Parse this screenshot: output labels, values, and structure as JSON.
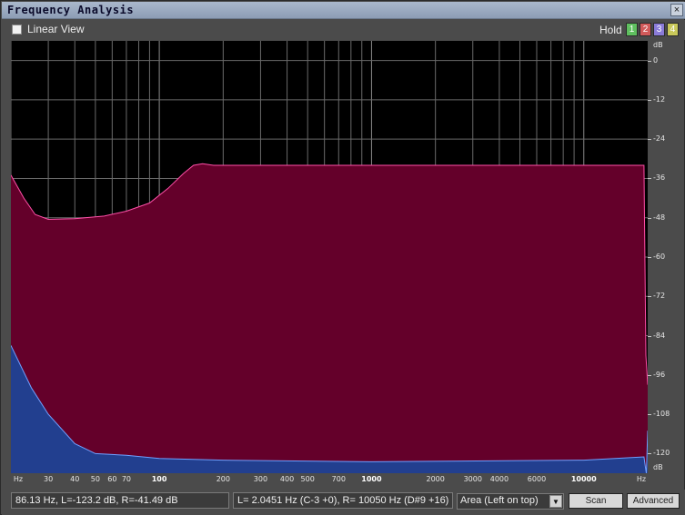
{
  "window": {
    "title": "Frequency Analysis",
    "close_glyph": "×"
  },
  "toolbar": {
    "linear_view_label": "Linear View",
    "linear_view_checked": false,
    "hold_label": "Hold",
    "hold_buttons": [
      {
        "label": "1",
        "color": "#5fbf5f"
      },
      {
        "label": "2",
        "color": "#d25a5a"
      },
      {
        "label": "3",
        "color": "#8a7bd8"
      },
      {
        "label": "4",
        "color": "#c8c85a"
      }
    ]
  },
  "colors": {
    "left_channel_fill": "#64002a",
    "left_channel_line": "#ff4fa8",
    "right_channel_fill": "#223f8f",
    "right_channel_line": "#6fa0ff",
    "grid": "#6a6a6a"
  },
  "chart_data": {
    "type": "area",
    "db_unit_label": "dB",
    "hz_unit_label": "Hz",
    "x_scale": "log",
    "xlim": [
      20,
      20000
    ],
    "ylim": [
      -126,
      6
    ],
    "y_ticks": [
      0,
      -12,
      -24,
      -36,
      -48,
      -60,
      -72,
      -84,
      -96,
      -108,
      -120
    ],
    "y_tick_labels": [
      "0",
      "-12",
      "-24",
      "-36",
      "-48",
      "-60",
      "-72",
      "-84",
      "-96",
      "-108",
      "-120"
    ],
    "x_ticks": [
      {
        "value": 30,
        "label": "30",
        "major": false
      },
      {
        "value": 40,
        "label": "40",
        "major": false
      },
      {
        "value": 50,
        "label": "50",
        "major": false
      },
      {
        "value": 60,
        "label": "60",
        "major": false
      },
      {
        "value": 70,
        "label": "70",
        "major": false
      },
      {
        "value": 100,
        "label": "100",
        "major": true
      },
      {
        "value": 200,
        "label": "200",
        "major": false
      },
      {
        "value": 300,
        "label": "300",
        "major": false
      },
      {
        "value": 400,
        "label": "400",
        "major": false
      },
      {
        "value": 500,
        "label": "500",
        "major": false
      },
      {
        "value": 700,
        "label": "700",
        "major": false
      },
      {
        "value": 1000,
        "label": "1000",
        "major": true
      },
      {
        "value": 2000,
        "label": "2000",
        "major": false
      },
      {
        "value": 3000,
        "label": "3000",
        "major": false
      },
      {
        "value": 4000,
        "label": "4000",
        "major": false
      },
      {
        "value": 6000,
        "label": "6000",
        "major": false
      },
      {
        "value": 10000,
        "label": "10000",
        "major": true
      }
    ],
    "grid": true,
    "series": [
      {
        "x": [
          20,
          23,
          26,
          30,
          40,
          55,
          70,
          90,
          110,
          130,
          145,
          160,
          180,
          1000,
          10000,
          19200,
          19600,
          20000
        ],
        "values": [
          -35,
          -42,
          -47,
          -48.5,
          -48.3,
          -47.5,
          -46,
          -43.5,
          -39,
          -34.5,
          -32,
          -31.5,
          -32,
          -32,
          -32,
          -32,
          -90,
          -99
        ]
      },
      {
        "x": [
          20,
          25,
          30,
          40,
          50,
          70,
          100,
          200,
          1000,
          10000,
          19200,
          19500,
          19700,
          20000
        ],
        "values": [
          -87,
          -100,
          -108,
          -117,
          -120,
          -120.5,
          -121.5,
          -122,
          -122.5,
          -122,
          -121,
          -124,
          -126,
          -113
        ]
      }
    ]
  },
  "status": {
    "cursor_readout": "86.13 Hz, L=-123.2 dB, R=-41.49 dB",
    "peak_readout": "L= 2.0451 Hz (C-3 +0), R=  10050 Hz (D#9 +16)",
    "view_mode": "Area (Left on top)",
    "dropdown_glyph": "▼",
    "scan_label": "Scan",
    "advanced_label": "Advanced"
  }
}
